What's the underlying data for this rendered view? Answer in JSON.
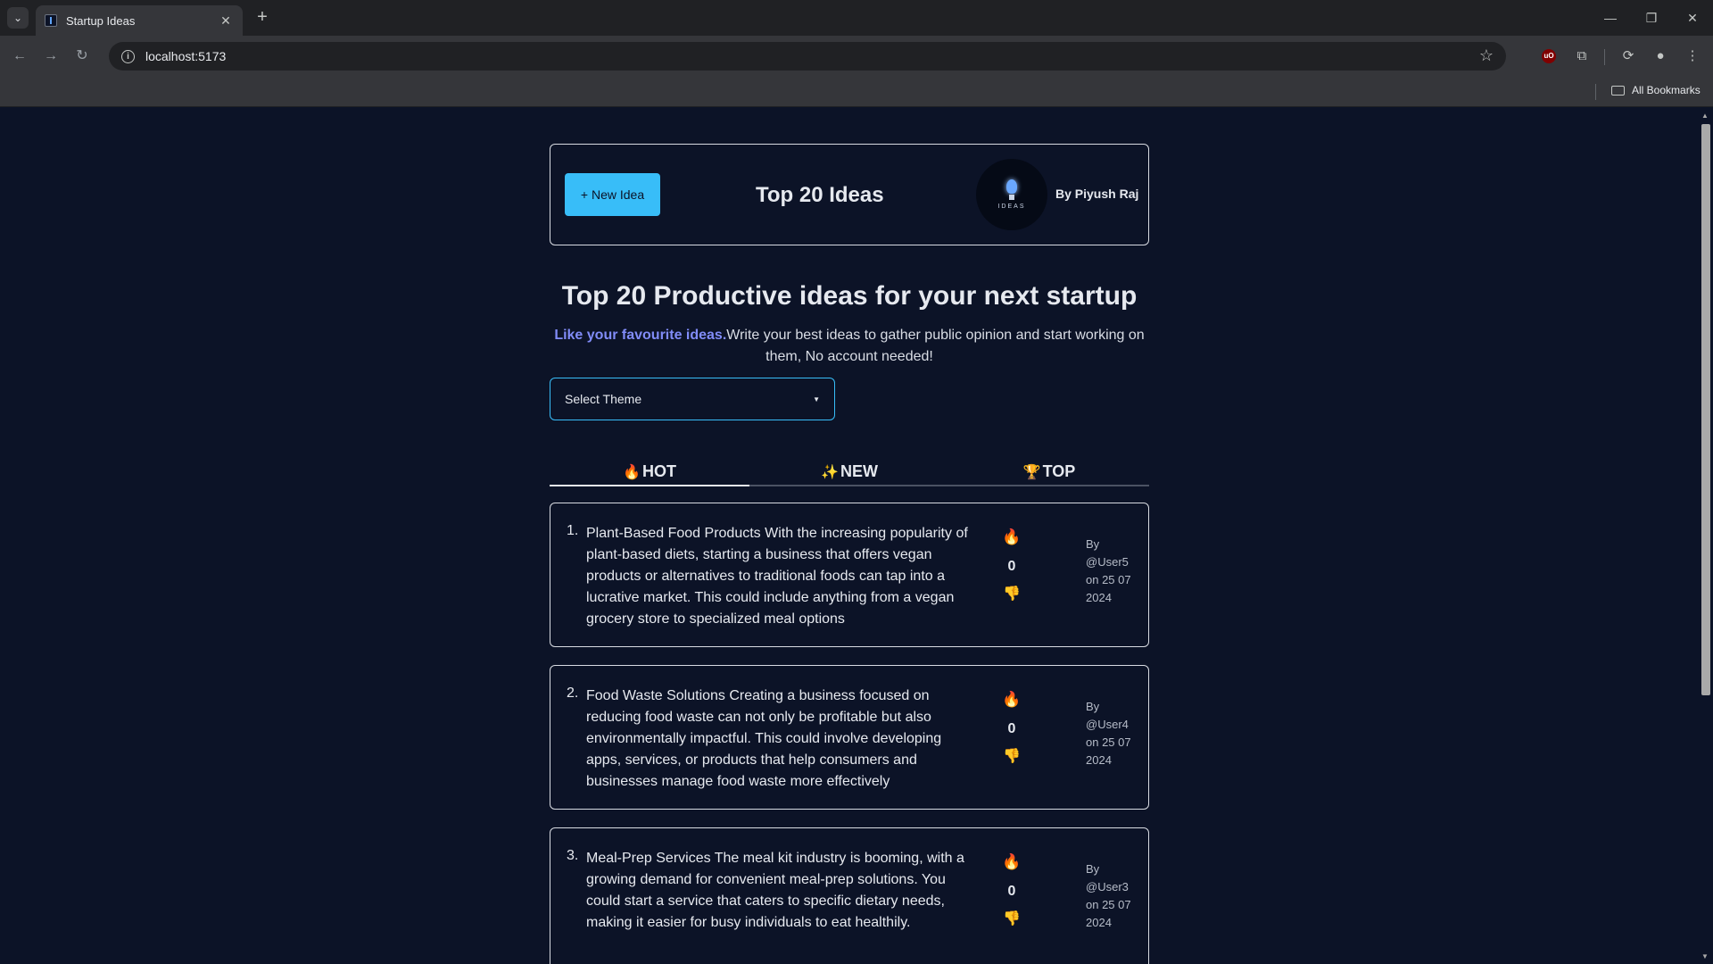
{
  "browser": {
    "tab_title": "Startup Ideas",
    "url": "localhost:5173",
    "all_bookmarks": "All Bookmarks"
  },
  "header": {
    "new_idea_label": "+ New Idea",
    "title": "Top 20 Ideas",
    "logo_text": "IDEAS",
    "author": "By Piyush Raj"
  },
  "hero": {
    "title": "Top 20 Productive ideas for your next startup",
    "accent": "Like your favourite ideas.",
    "subtitle": "Write your best ideas to gather public opinion and start working on them, No account needed!"
  },
  "theme_select": {
    "label": "Select Theme"
  },
  "tabs": [
    {
      "emoji": "🔥",
      "label": "HOT",
      "active": true
    },
    {
      "emoji": "✨",
      "label": "NEW",
      "active": false
    },
    {
      "emoji": "🏆",
      "label": "TOP",
      "active": false
    }
  ],
  "ideas": [
    {
      "num": "1.",
      "text": "Plant-Based Food Products With the increasing popularity of plant-based diets, starting a business that offers vegan products or alternatives to traditional foods can tap into a lucrative market. This could include anything from a vegan grocery store to specialized meal options",
      "votes": "0",
      "meta": "By @User5 on 25 07 2024"
    },
    {
      "num": "2.",
      "text": "Food Waste Solutions Creating a business focused on reducing food waste can not only be profitable but also environmentally impactful. This could involve developing apps, services, or products that help consumers and businesses manage food waste more effectively",
      "votes": "0",
      "meta": "By @User4 on 25 07 2024"
    },
    {
      "num": "3.",
      "text": "Meal-Prep Services The meal kit industry is booming, with a growing demand for convenient meal-prep solutions. You could start a service that caters to specific dietary needs, making it easier for busy individuals to eat healthily.",
      "votes": "0",
      "meta": "By @User3 on 25 07 2024"
    }
  ],
  "icons": {
    "upvote": "🔥",
    "downvote": "👎"
  }
}
